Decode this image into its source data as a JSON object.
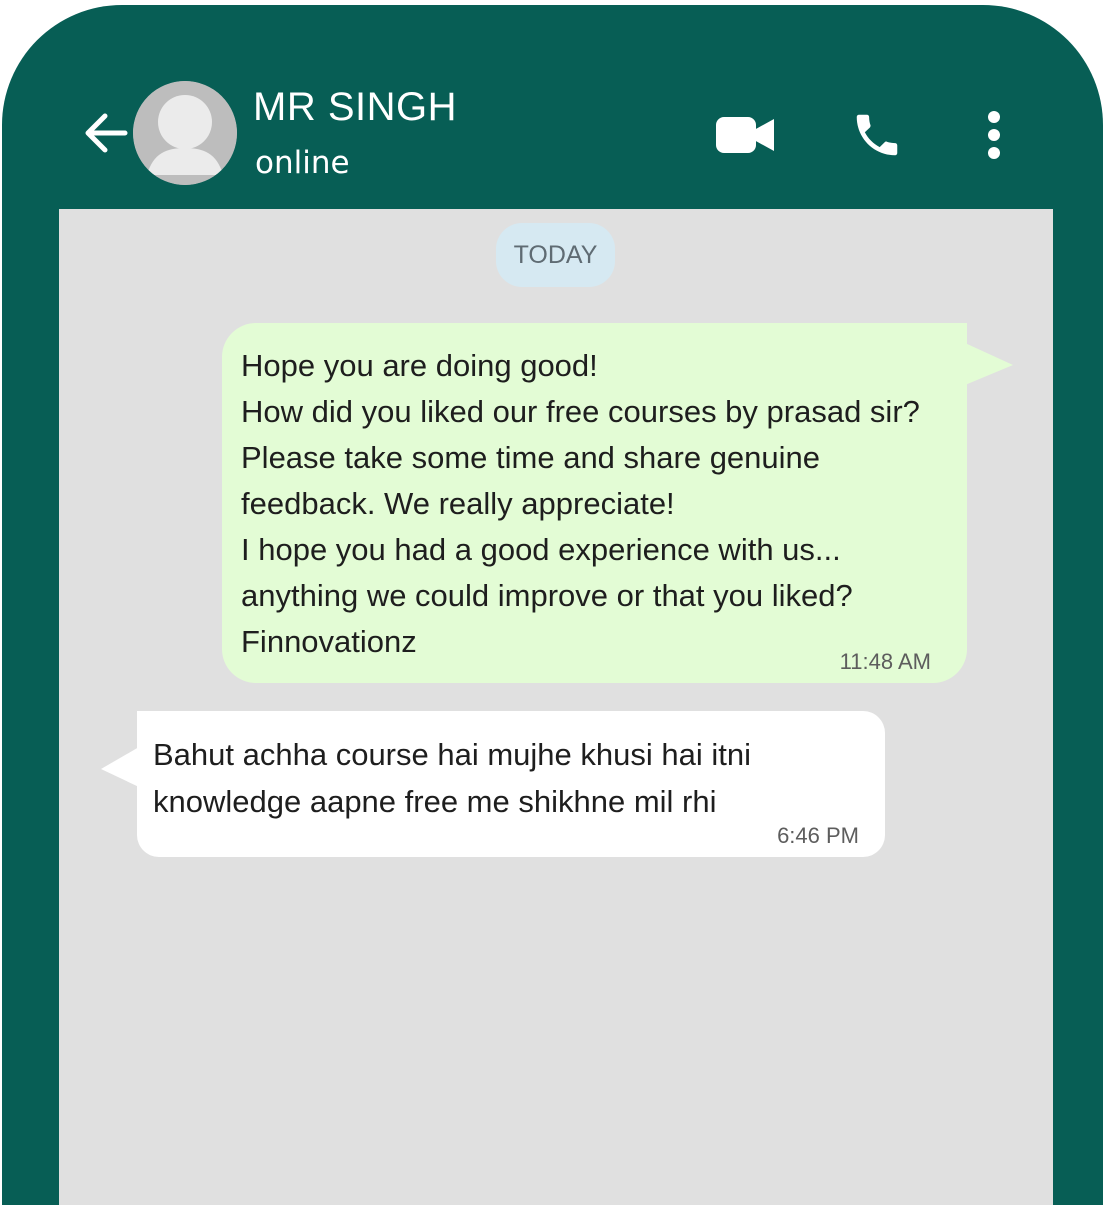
{
  "header": {
    "contact_name": "MR SINGH",
    "contact_status": "online",
    "icons": [
      "back-arrow-icon",
      "avatar-placeholder-icon",
      "video-call-icon",
      "phone-icon",
      "more-vertical-icon"
    ]
  },
  "chat": {
    "date_label": "TODAY",
    "messages": [
      {
        "direction": "outgoing",
        "text": "Hope you are doing good!\nHow did you liked our free courses by prasad sir? Please take some time and share genuine feedback. We really appreciate!\nI hope you had a good experience with us...\nanything we could improve or that you liked?\nFinnovationz",
        "time": "11:48 AM"
      },
      {
        "direction": "incoming",
        "text": "Bahut achha course hai mujhe khusi hai itni knowledge aapne free me shikhne mil rhi",
        "time": "6:46 PM"
      }
    ]
  },
  "colors": {
    "header": "#075e55",
    "chat_background": "#e0e0e0",
    "outgoing_bubble": "#e3fcd5",
    "incoming_bubble": "#ffffff",
    "date_chip": "#d6e9f2"
  }
}
